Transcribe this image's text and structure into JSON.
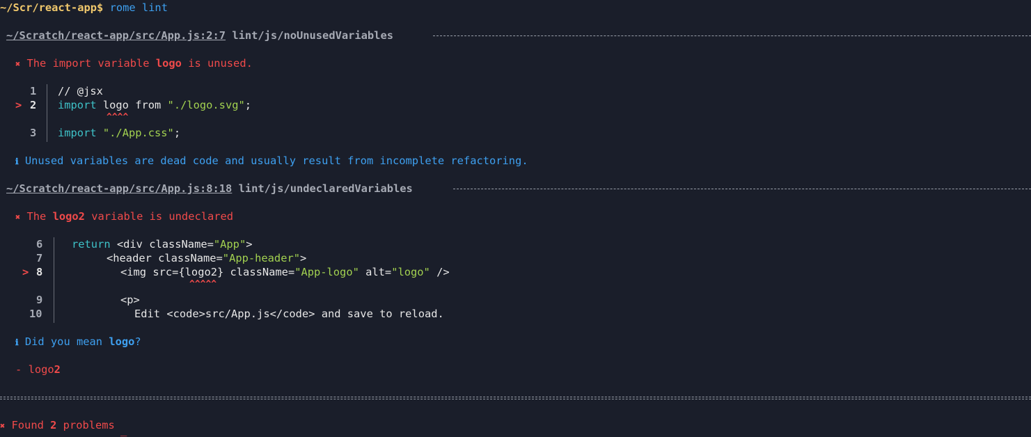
{
  "terminal": {
    "prompt_path": "~/Scr/react-app",
    "prompt_symbol": "$",
    "command": "rome lint",
    "cursor": "_"
  },
  "diagnostics": [
    {
      "location": "~/Scratch/react-app/src/App.js:2:7",
      "rule": "lint/js/noUnusedVariables",
      "error_icon": "✖",
      "message_pre": "The import variable ",
      "message_var": "logo",
      "message_post": " is unused.",
      "code_lines": [
        {
          "marker": "",
          "num": "1",
          "text": "// @jsx"
        },
        {
          "marker": ">",
          "num": "2",
          "kw": "import",
          "mid": " logo from ",
          "str": "\"./logo.svg\"",
          "end": ";"
        },
        {
          "marker": "",
          "num": "3",
          "kw": "import",
          "mid": " ",
          "str": "\"./App.css\"",
          "end": ";"
        }
      ],
      "carets": "^^^^",
      "info_icon": "ℹ",
      "info": "Unused variables are dead code and usually result from incomplete refactoring."
    },
    {
      "location": "~/Scratch/react-app/src/App.js:8:18",
      "rule": "lint/js/undeclaredVariables",
      "error_icon": "✖",
      "message_pre": "The ",
      "message_var": "logo2",
      "message_post": " variable is undeclared",
      "code_lines": [
        {
          "marker": "",
          "num": "6",
          "kw": "return",
          "mid": " <div className=",
          "str": "\"App\"",
          "end": ">"
        },
        {
          "marker": "",
          "num": "7",
          "mid": "<header className=",
          "str": "\"App-header\"",
          "end": ">"
        },
        {
          "marker": ">",
          "num": "8",
          "mid": "<img src={logo2} className=",
          "str": "\"App-logo\"",
          "mid2": " alt=",
          "str2": "\"logo\"",
          "end": " />"
        },
        {
          "marker": "",
          "num": "9",
          "text": "<p>"
        },
        {
          "marker": "",
          "num": "10",
          "text": "Edit <code>src/App.js</code> and save to reload."
        }
      ],
      "carets": "^^^^^",
      "info_icon": "ℹ",
      "info_pre": "Did you mean ",
      "info_var": "logo",
      "info_post": "?",
      "diff_minus": "-",
      "diff_pre": "logo",
      "diff_bold": "2"
    }
  ],
  "summary": {
    "icon": "✖",
    "pre": "Found ",
    "count": "2",
    "post": " problems"
  }
}
